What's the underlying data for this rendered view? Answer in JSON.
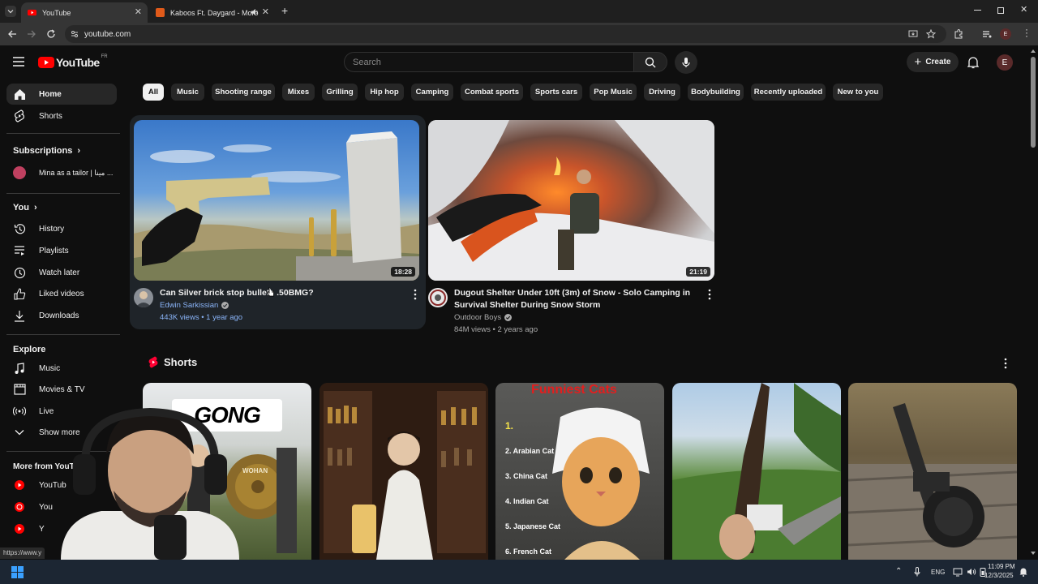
{
  "browser": {
    "tabs": [
      {
        "title": "YouTube",
        "active": true
      },
      {
        "title": "Kaboos Ft. Daygard - Moro",
        "active": false
      }
    ],
    "url": "youtube.com",
    "status_url": "https://www.y"
  },
  "header": {
    "logo_text": "YouTube",
    "region": "FR",
    "search_placeholder": "Search",
    "create_label": "Create",
    "avatar_letter": "E"
  },
  "sidebar": {
    "main": [
      {
        "label": "Home",
        "icon": "home-icon",
        "active": true
      },
      {
        "label": "Shorts",
        "icon": "shorts-icon",
        "active": false
      }
    ],
    "subscriptions_label": "Subscriptions",
    "subscriptions": [
      {
        "label": "Mina as a tailor | مينا ..."
      }
    ],
    "you_label": "You",
    "you_items": [
      {
        "label": "History",
        "icon": "history-icon"
      },
      {
        "label": "Playlists",
        "icon": "playlists-icon"
      },
      {
        "label": "Watch later",
        "icon": "watch-later-icon"
      },
      {
        "label": "Liked videos",
        "icon": "like-icon"
      },
      {
        "label": "Downloads",
        "icon": "download-icon"
      }
    ],
    "explore_label": "Explore",
    "explore_items": [
      {
        "label": "Music",
        "icon": "music-icon"
      },
      {
        "label": "Movies & TV",
        "icon": "movies-icon"
      },
      {
        "label": "Live",
        "icon": "live-icon"
      },
      {
        "label": "Show more",
        "icon": "chevron-down-icon"
      }
    ],
    "more_label": "More from YouTu",
    "more_items": [
      {
        "label": "YouTub"
      },
      {
        "label": "You"
      },
      {
        "label": "Y"
      }
    ]
  },
  "chips": [
    "All",
    "Music",
    "Shooting range",
    "Mixes",
    "Grilling",
    "Hip hop",
    "Camping",
    "Combat sports",
    "Sports cars",
    "Pop Music",
    "Driving",
    "Bodybuilding",
    "Recently uploaded",
    "New to you"
  ],
  "videos": [
    {
      "title": "Can Silver brick stop bullets .50BMG?",
      "channel": "Edwin Sarkissian",
      "meta": "443K views • 1 year ago",
      "duration": "18:28"
    },
    {
      "title_line1": "Dugout Shelter Under 10ft (3m) of Snow - Solo Camping in",
      "title_line2": "Survival Shelter During Snow Storm",
      "channel": "Outdoor Boys",
      "meta": "84M views • 2 years ago",
      "duration": "21:19"
    }
  ],
  "shorts": {
    "label": "Shorts",
    "short1_text": "GONG",
    "short1_sign": "WOHAN",
    "short3_title": "Funniest Cats",
    "short3_list": [
      "1.",
      "2. Arabian Cat",
      "3. China Cat",
      "4. Indian Cat",
      "5. Japanese Cat",
      "6. French Cat"
    ]
  },
  "taskbar": {
    "lang": "ENG",
    "time": "11:09 PM",
    "date": "12/3/2025"
  }
}
